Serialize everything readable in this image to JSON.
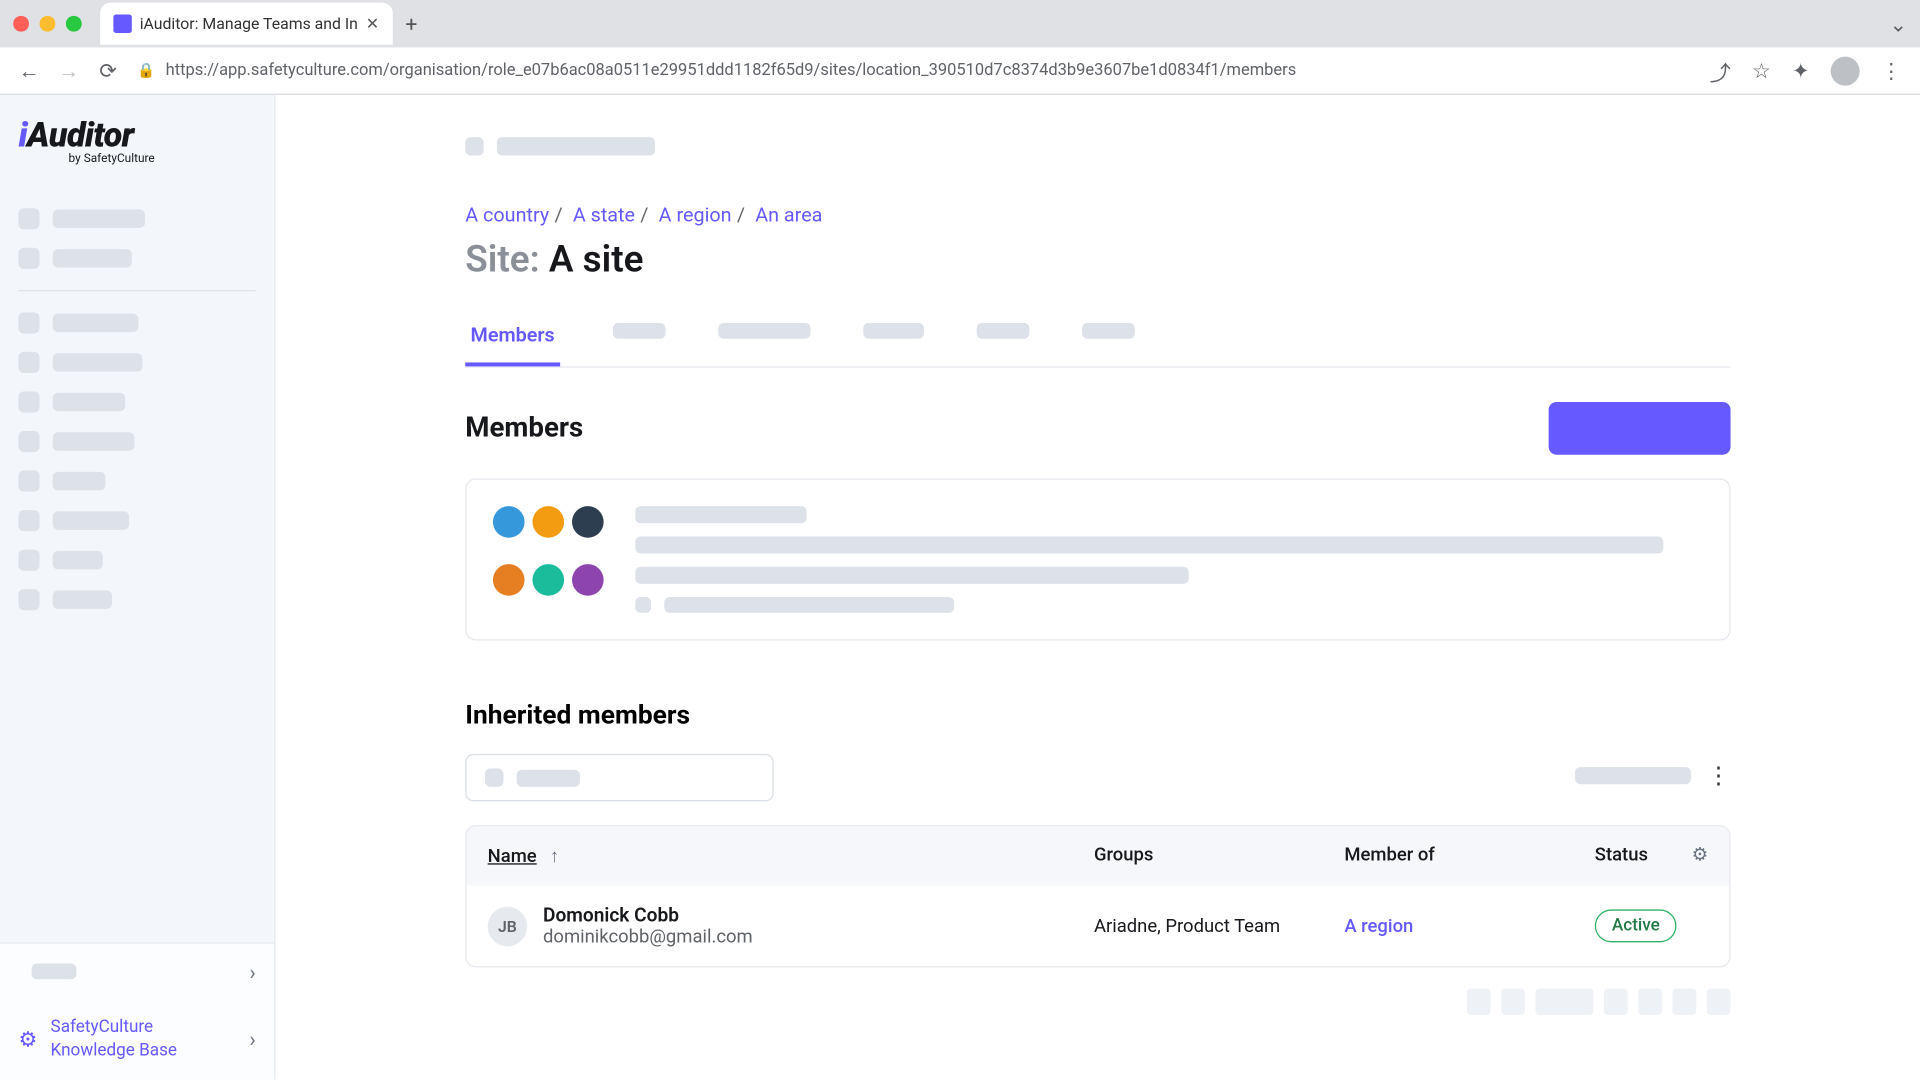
{
  "browser": {
    "tab_title": "iAuditor: Manage Teams and In",
    "url": "https://app.safetyculture.com/organisation/role_e07b6ac08a0511e29951ddd1182f65d9/sites/location_390510d7c8374d3b9e3607be1d0834f1/members"
  },
  "logo": {
    "text": "iAuditor",
    "sub": "by SafetyCulture"
  },
  "breadcrumb": {
    "items": [
      "A country",
      "A state",
      "A region",
      "An area"
    ]
  },
  "page_title": {
    "prefix": "Site: ",
    "name": "A site"
  },
  "tabs": {
    "active": "Members"
  },
  "sections": {
    "members": "Members",
    "inherited": "Inherited members"
  },
  "table": {
    "columns": {
      "name": "Name",
      "groups": "Groups",
      "member_of": "Member of",
      "status": "Status"
    },
    "rows": [
      {
        "initials": "JB",
        "name": "Domonick Cobb",
        "email": "dominikcobb@gmail.com",
        "groups": "Ariadne, Product Team",
        "member_of": "A region",
        "status": "Active"
      }
    ]
  },
  "sidebar_bottom": {
    "kb": "SafetyCulture Knowledge Base"
  },
  "avatar_colors": [
    "#3498db",
    "#f39c12",
    "#2c3e50",
    "#e67e22",
    "#1abc9c",
    "#8e44ad"
  ]
}
